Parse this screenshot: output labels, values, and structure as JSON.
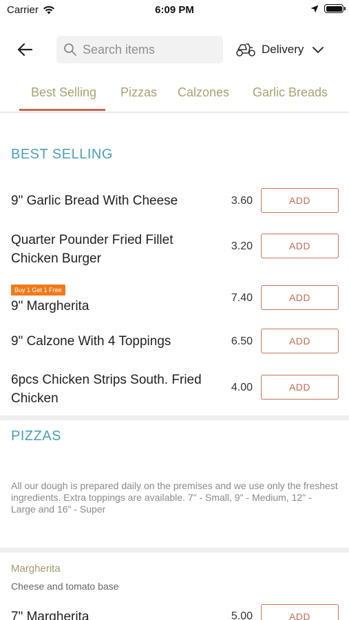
{
  "status_bar": {
    "carrier": "Carrier",
    "time": "6:09 PM"
  },
  "header": {
    "search_placeholder": "Search items",
    "delivery_label": "Delivery"
  },
  "tabs": [
    {
      "label": "Best Selling",
      "active": true
    },
    {
      "label": "Pizzas"
    },
    {
      "label": "Calzones"
    },
    {
      "label": "Garlic Breads"
    }
  ],
  "best_selling": {
    "title": "BEST SELLING",
    "items": [
      {
        "name": "9\" Garlic Bread With Cheese",
        "price": "3.60",
        "add_label": "ADD"
      },
      {
        "name": "Quarter Pounder Fried Fillet Chicken Burger",
        "price": "3.20",
        "add_label": "ADD"
      },
      {
        "name": "9\" Margherita",
        "price": "7.40",
        "add_label": "ADD",
        "badge": "Buy 1 Get 1 Free"
      },
      {
        "name": "9\" Calzone With 4 Toppings",
        "price": "6.50",
        "add_label": "ADD"
      },
      {
        "name": "6pcs Chicken Strips South. Fried Chicken",
        "price": "4.00",
        "add_label": "ADD"
      }
    ]
  },
  "pizzas": {
    "title": "PIZZAS",
    "description": "All our dough is prepared daily on the premises and we use only the freshest ingredients. Extra toppings are available. 7\" - Small, 9\" - Medium, 12\" - Large and 16\" - Super",
    "subcategory": {
      "title": "Margherita",
      "description": "Cheese and tomato base",
      "items": [
        {
          "name": "7\" Margherita",
          "price": "5.00",
          "add_label": "ADD"
        }
      ]
    }
  },
  "colors": {
    "accent": "#c7664a",
    "section_title": "#4aa0b8",
    "tab_text": "#a8a274",
    "badge": "#f07a1a"
  }
}
